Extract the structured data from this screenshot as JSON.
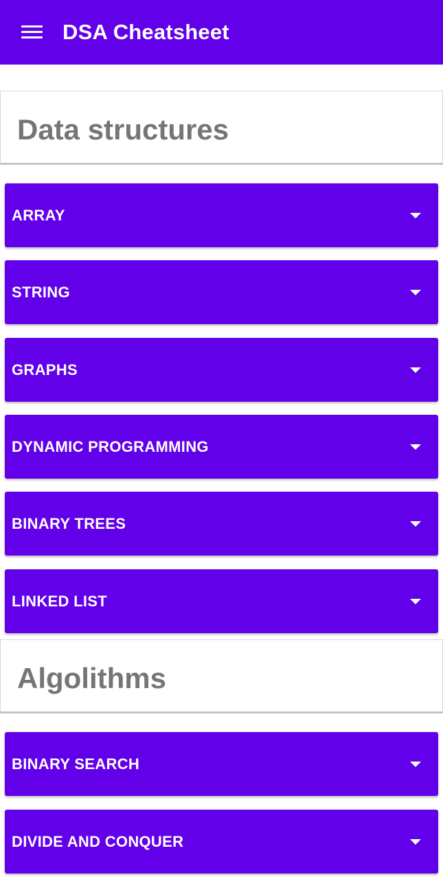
{
  "appbar": {
    "title": "DSA Cheatsheet",
    "menu_icon": "hamburger-menu-icon"
  },
  "sections": [
    {
      "title": "Data structures",
      "items": [
        {
          "label": "ARRAY",
          "icon": "arrow-drop-down-icon"
        },
        {
          "label": "STRING",
          "icon": "arrow-drop-down-icon"
        },
        {
          "label": "GRAPHS",
          "icon": "arrow-drop-down-icon"
        },
        {
          "label": "DYNAMIC PROGRAMMING",
          "icon": "arrow-drop-down-icon"
        },
        {
          "label": "BINARY TREES",
          "icon": "arrow-drop-down-icon"
        },
        {
          "label": "LINKED LIST",
          "icon": "arrow-drop-down-icon"
        }
      ]
    },
    {
      "title": "Algolithms",
      "items": [
        {
          "label": "BINARY SEARCH",
          "icon": "arrow-drop-down-icon"
        },
        {
          "label": "DIVIDE AND CONQUER",
          "icon": "arrow-drop-down-icon"
        }
      ]
    }
  ],
  "colors": {
    "primary": "#6200ea",
    "on_primary": "#ffffff",
    "section_title": "#757575"
  }
}
